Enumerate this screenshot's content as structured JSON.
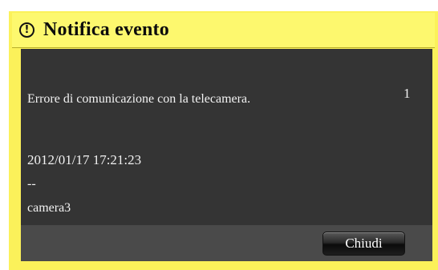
{
  "dialog": {
    "title": "Notifica evento",
    "icon": "exclamation-circle-icon",
    "title_bar_color": "#fdf86e",
    "panel_color": "#343434"
  },
  "event": {
    "message": "Errore di comunicazione con la telecamera.",
    "count": "1",
    "timestamp": "2012/01/17 17:21:23",
    "separator": "--",
    "camera": "camera3"
  },
  "actions": {
    "close_label": "Chiudi"
  }
}
